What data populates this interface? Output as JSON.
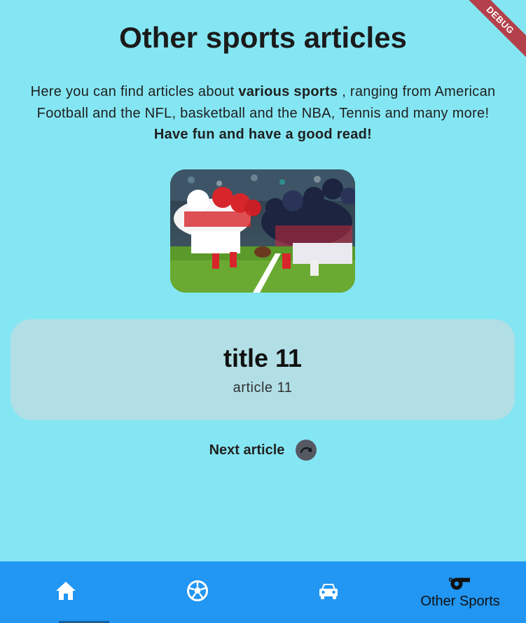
{
  "debug_banner": "DEBUG",
  "page": {
    "title": "Other sports articles",
    "intro_prefix": "Here you can find articles about ",
    "intro_bold": "various sports",
    "intro_suffix": " , ranging from American Football and the NFL, basketball and the NBA, Tennis and many more!",
    "intro_fun": "Have fun and have a good read!"
  },
  "article": {
    "title": "title 11",
    "body": "article 11"
  },
  "next": {
    "label": "Next article",
    "icon": "redo-arrow-icon"
  },
  "bottom_nav": {
    "items": [
      {
        "icon": "home-icon",
        "label": ""
      },
      {
        "icon": "soccer-ball-icon",
        "label": ""
      },
      {
        "icon": "car-icon",
        "label": ""
      },
      {
        "icon": "whistle-icon",
        "label": "Other Sports"
      }
    ],
    "selected_index": 3
  },
  "colors": {
    "background": "#85e6f3",
    "card": "#b1dfe5",
    "nav_bar": "#2196f3",
    "debug": "#b3404a"
  }
}
